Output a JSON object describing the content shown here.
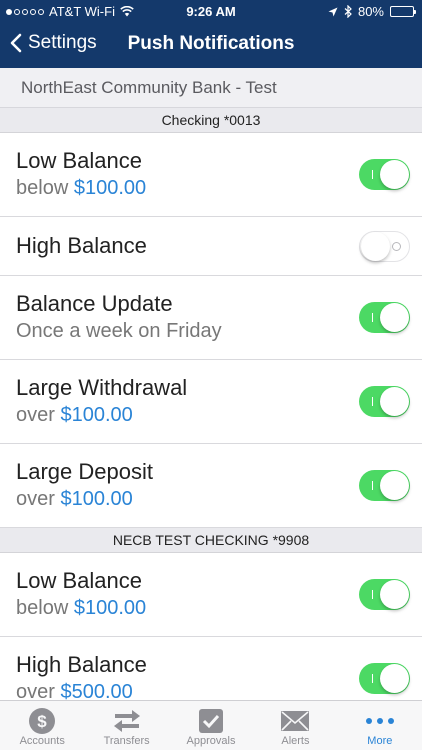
{
  "status": {
    "carrier": "AT&T Wi-Fi",
    "time": "9:26 AM",
    "battery": "80%",
    "battery_level": 0.8
  },
  "nav": {
    "back_label": "Settings",
    "title": "Push Notifications"
  },
  "bank_name": "NorthEast Community Bank - Test",
  "accounts": [
    {
      "name": "Checking *0013",
      "alerts": [
        {
          "title": "Low Balance",
          "prefix": "below",
          "amount": "$100.00",
          "enabled": true
        },
        {
          "title": "High Balance",
          "prefix": "",
          "amount": "",
          "enabled": false
        },
        {
          "title": "Balance Update",
          "prefix": "Once a week on Friday",
          "amount": "",
          "enabled": true
        },
        {
          "title": "Large Withdrawal",
          "prefix": "over",
          "amount": "$100.00",
          "enabled": true
        },
        {
          "title": "Large Deposit",
          "prefix": "over",
          "amount": "$100.00",
          "enabled": true
        }
      ]
    },
    {
      "name": "NECB TEST CHECKING *9908",
      "alerts": [
        {
          "title": "Low Balance",
          "prefix": "below",
          "amount": "$100.00",
          "enabled": true
        },
        {
          "title": "High Balance",
          "prefix": "over",
          "amount": "$500.00",
          "enabled": true
        }
      ]
    }
  ],
  "tabs": [
    {
      "label": "Accounts",
      "icon": "dollar-coin-icon",
      "active": false
    },
    {
      "label": "Transfers",
      "icon": "transfer-arrows-icon",
      "active": false
    },
    {
      "label": "Approvals",
      "icon": "checkbox-icon",
      "active": false
    },
    {
      "label": "Alerts",
      "icon": "envelope-icon",
      "active": false
    },
    {
      "label": "More",
      "icon": "more-dots-icon",
      "active": true
    }
  ],
  "colors": {
    "header": "#14396b",
    "accent": "#2a84d6",
    "toggle_on": "#4cd964"
  }
}
